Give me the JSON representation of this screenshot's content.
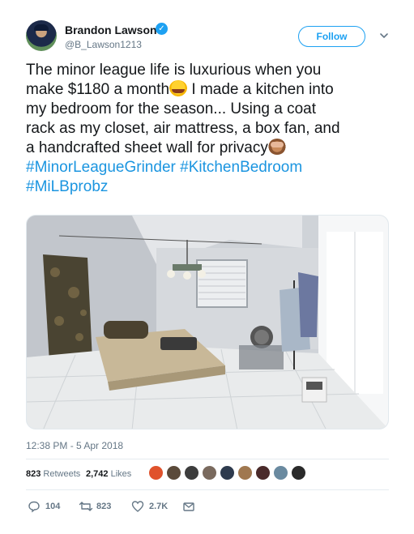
{
  "user": {
    "display_name": "Brandon Lawson",
    "handle": "@B_Lawson1213",
    "verified": true
  },
  "follow_button": {
    "label": "Follow"
  },
  "tweet": {
    "lines": [
      "The minor league life is luxurious when you",
      "make $1180 a month",
      " I made a kitchen into",
      "my bedroom for the season... Using a coat",
      "rack as my closet, air mattress, a box fan, and",
      "a handcrafted sheet wall for privacy"
    ],
    "hashtags": [
      "#MinorLeagueGrinder",
      "#KitchenBedroom",
      "#MiLBprobz"
    ],
    "emojis": [
      "face-with-tears-of-joy",
      "see-no-evil-monkey"
    ]
  },
  "timestamp": "12:38 PM - 5 Apr 2018",
  "stats": {
    "retweets_count": "823",
    "retweets_label": "Retweets",
    "likes_count": "2,742",
    "likes_label": "Likes"
  },
  "actions": {
    "replies": "104",
    "retweets": "823",
    "likes": "2.7K"
  },
  "colors": {
    "accent": "#1da1f2",
    "link": "#1b95e0",
    "muted": "#657786"
  }
}
